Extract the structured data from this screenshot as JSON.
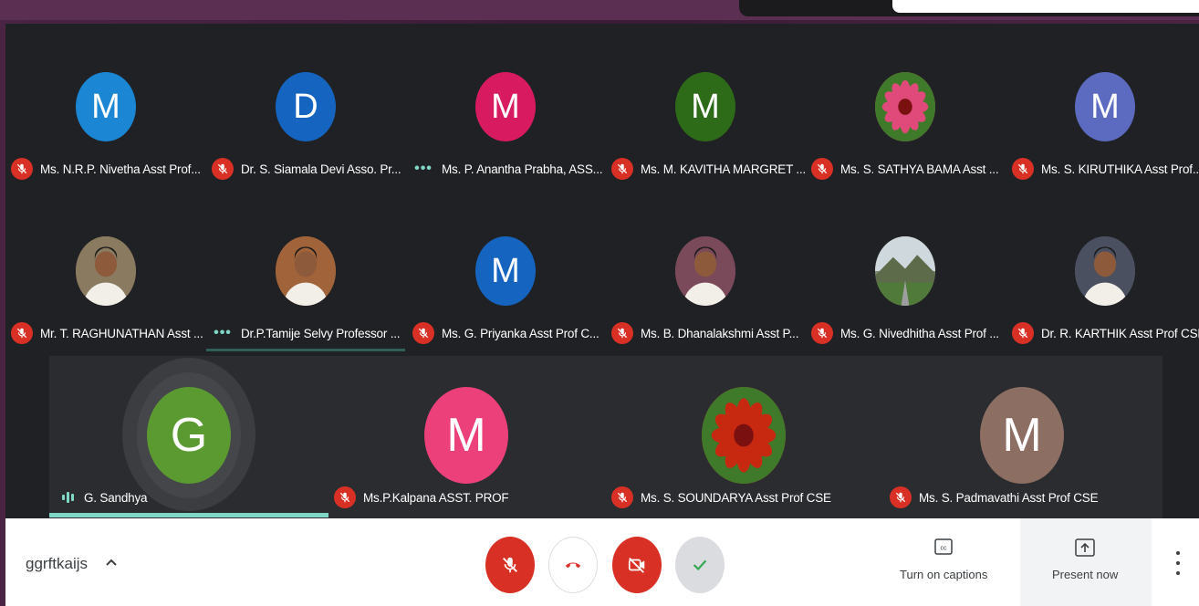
{
  "meeting_code": "ggrftkaijs",
  "participants_row1": [
    {
      "name": "Ms. N.R.P. Nivetha Asst Prof...",
      "initial": "M",
      "color": "#1a86d4",
      "status": "muted",
      "avatar_icon": ""
    },
    {
      "name": "Dr. S. Siamala Devi Asso. Pr...",
      "initial": "D",
      "color": "#1565c0",
      "status": "muted",
      "avatar_icon": ""
    },
    {
      "name": "Ms. P. Anantha Prabha, ASS...",
      "initial": "M",
      "color": "#d81b60",
      "status": "more",
      "avatar_icon": ""
    },
    {
      "name": "Ms. M. KAVITHA MARGRET ...",
      "initial": "M",
      "color": "#2e6b18",
      "status": "muted",
      "avatar_icon": ""
    },
    {
      "name": "Ms. S. SATHYA BAMA Asst ...",
      "initial": "",
      "color": "#e04a7a",
      "status": "muted",
      "avatar_icon": "flower-photo"
    },
    {
      "name": "Ms. S. KIRUTHIKA Asst Prof...",
      "initial": "M",
      "color": "#5c6bc0",
      "status": "muted",
      "avatar_icon": ""
    }
  ],
  "participants_row2": [
    {
      "name": "Mr. T. RAGHUNATHAN Asst ...",
      "initial": "",
      "color": "#8a7a60",
      "status": "muted",
      "avatar_icon": "person-photo"
    },
    {
      "name": "Dr.P.Tamije Selvy Professor ...",
      "initial": "",
      "color": "#a0633a",
      "status": "more",
      "avatar_icon": "person-photo"
    },
    {
      "name": "Ms. G. Priyanka Asst Prof C...",
      "initial": "M",
      "color": "#1565c0",
      "status": "muted",
      "avatar_icon": ""
    },
    {
      "name": "Ms. B. Dhanalakshmi Asst P...",
      "initial": "",
      "color": "#7a4a5a",
      "status": "muted",
      "avatar_icon": "person-photo"
    },
    {
      "name": "Ms. G. Nivedhitha Asst Prof ...",
      "initial": "",
      "color": "#7a8a70",
      "status": "muted",
      "avatar_icon": "landscape-photo"
    },
    {
      "name": "Dr. R. KARTHIK Asst Prof CSE",
      "initial": "",
      "color": "#4a5060",
      "status": "muted",
      "avatar_icon": "person-photo"
    }
  ],
  "participants_row3": [
    {
      "name": "G. Sandhya",
      "initial": "G",
      "color": "#5b9a30",
      "status": "speaking",
      "avatar_icon": ""
    },
    {
      "name": "Ms.P.Kalpana ASST. PROF",
      "initial": "M",
      "color": "#ec407a",
      "status": "muted",
      "avatar_icon": ""
    },
    {
      "name": "Ms. S. SOUNDARYA Asst Prof CSE",
      "initial": "",
      "color": "#c62810",
      "status": "muted",
      "avatar_icon": "flower-photo"
    },
    {
      "name": "Ms. S. Padmavathi Asst Prof CSE",
      "initial": "M",
      "color": "#8d6e63",
      "status": "muted",
      "avatar_icon": ""
    }
  ],
  "controls": {
    "mic": "mic-off-icon",
    "leave": "end-call-icon",
    "camera": "camera-off-icon",
    "confirm": "check-icon"
  },
  "actions": {
    "captions_label": "Turn on captions",
    "captions_icon": "cc",
    "present_label": "Present now",
    "present_icon": "present-icon"
  }
}
